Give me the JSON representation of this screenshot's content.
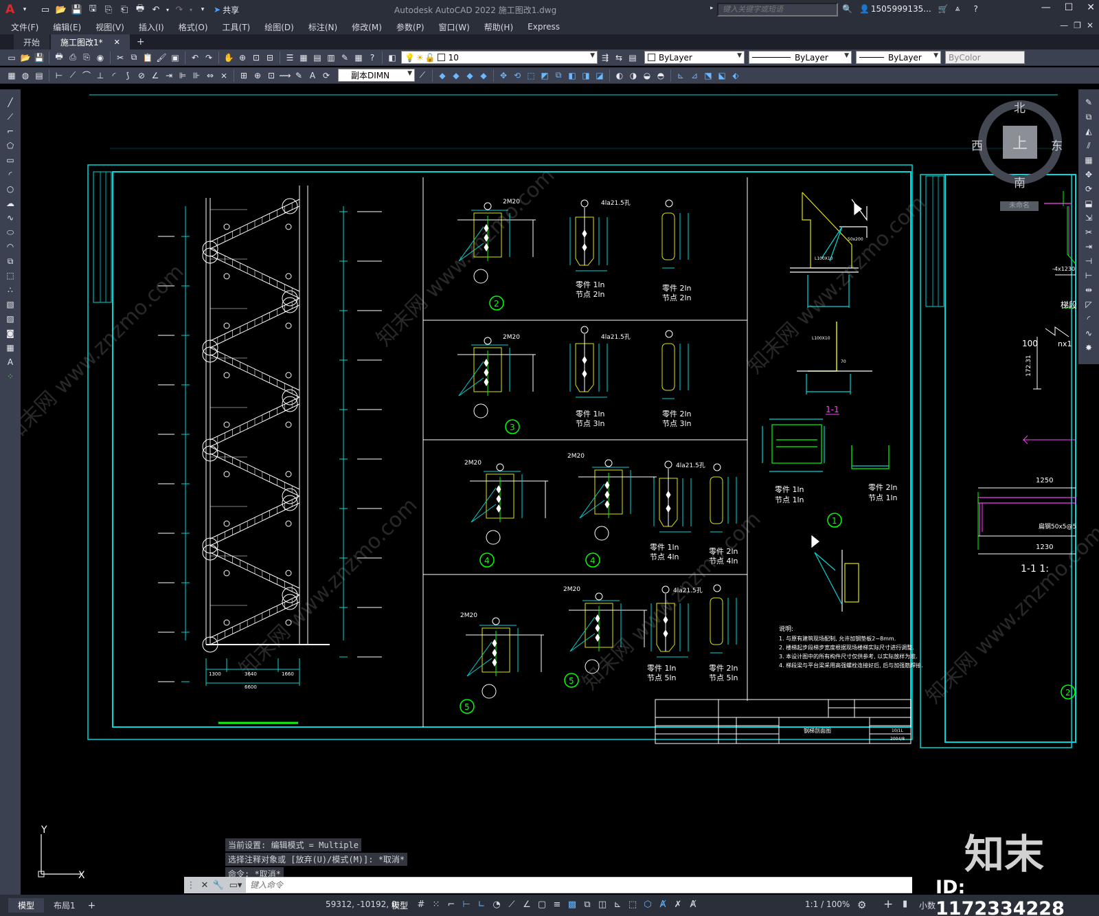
{
  "titlebar": {
    "app_title": "Autodesk AutoCAD 2022    施工图改1.dwg",
    "share_label": "共享",
    "search_placeholder": "键入关键字或短语",
    "username": "1505999135...",
    "window_controls": [
      "minimize-icon",
      "restore-icon",
      "close-icon"
    ]
  },
  "menu": {
    "items": [
      "文件(F)",
      "编辑(E)",
      "视图(V)",
      "插入(I)",
      "格式(O)",
      "工具(T)",
      "绘图(D)",
      "标注(N)",
      "修改(M)",
      "参数(P)",
      "窗口(W)",
      "帮助(H)",
      "Express"
    ]
  },
  "tabs": {
    "items": [
      "开始",
      "施工图改1*"
    ],
    "active_index": 1
  },
  "toolbar": {
    "layer_value": "10",
    "color_value": "ByLayer",
    "linetype_value": "ByLayer",
    "lineweight_value": "ByLayer",
    "plotstyle_value": "ByColor",
    "dimstyle_value": "副本DIMN"
  },
  "viewcube": {
    "north": "北",
    "south": "南",
    "east": "东",
    "west": "西",
    "face": "上",
    "wcs": "未命名"
  },
  "drawing": {
    "elevation_dims": [
      "1300",
      "3640",
      "1660",
      "6600"
    ],
    "part_labels": [
      "零件 1ln",
      "节点 2ln",
      "零件 2ln",
      "节点 2ln",
      "零件 1ln",
      "节点 3ln",
      "零件 2ln",
      "节点 3ln",
      "零件 1ln",
      "节点 4ln",
      "零件 2ln",
      "节点 4ln",
      "零件 1ln",
      "节点 5ln",
      "零件 2ln",
      "节点 5ln",
      "零件 1ln",
      "节点 1ln",
      "零件 2ln",
      "节点 1ln"
    ],
    "bolt_labels": [
      "2M20",
      "4la21.5孔",
      "2M20",
      "4la21.5孔",
      "2M20",
      "2M20",
      "4la21.5孔",
      "2M20",
      "2M20",
      "4la21.5孔"
    ],
    "node_numbers": [
      "2",
      "3",
      "4",
      "4",
      "5",
      "5",
      "1",
      "2"
    ],
    "section_label": "1-1",
    "notes_title": "说明:",
    "notes": [
      "1. 与原有建筑现场配制, 允许加钢垫板2~8mm.",
      "2. 楼梯起步段梯步宽度根据现场楼梯实际尺寸进行调整.",
      "3. 本设计图中的所有构件尺寸仅供参考, 以实际放样为准.",
      "4. 梯段梁与平台梁采用高强螺栓连接好后, 后与加强筋焊接."
    ],
    "title_block": {
      "drawing_name": "钢梯剖面图",
      "scale": "10/1L",
      "date": "2004/8"
    },
    "right_partial": [
      "100",
      "nx1",
      "172.31",
      "1250",
      "1230",
      "1-1  1:",
      "-4x1230",
      "梯段",
      "扁钢50x5@5"
    ],
    "detail_labels": [
      "L100X10",
      "50x200",
      "L100X10",
      "70"
    ]
  },
  "command": {
    "history": [
      "当前设置: 编辑模式 = Multiple",
      "选择注释对象或 [放弃(U)/模式(M)]: *取消*",
      "命令: *取消*"
    ],
    "input_placeholder": "键入命令"
  },
  "status": {
    "layout_tabs": [
      "模型",
      "布局1"
    ],
    "coordinates": "59312, -10192, 0",
    "model_label": "模型",
    "scale": "1:1 / 100%",
    "units": "小数"
  },
  "watermark": {
    "brand": "知末",
    "id_text": "ID: 1172334228",
    "diagonal": "知末网 www.znzmo.com"
  },
  "colors": {
    "frame": "#00d7d7",
    "yellow": "#e6e600",
    "green": "#00ff00",
    "white": "#ffffff",
    "magenta": "#ff40ff"
  }
}
